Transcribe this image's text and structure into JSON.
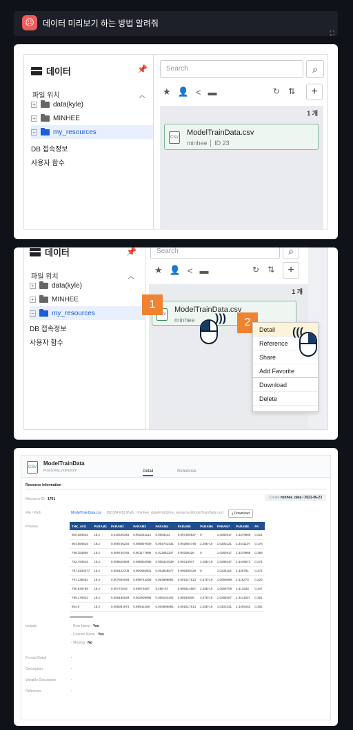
{
  "header": {
    "emoji": "☹",
    "title": "데이터 미리보기 하는 방법 알려줘",
    "expand_icon": "expand-icon"
  },
  "panel": {
    "title": "데이터",
    "section": "파일 위치",
    "tree": [
      "data(kyle)",
      "MINHEE",
      "my_resources"
    ],
    "menu": [
      "DB 접속정보",
      "사용자 함수"
    ],
    "search_placeholder": "Search",
    "count": "1 개",
    "file": {
      "name": "ModelTrainData.csv",
      "meta": "minhee │ ID 23",
      "meta_short": "minhee"
    }
  },
  "steps": {
    "one": "1",
    "two": "2"
  },
  "context_menu": [
    "Detail",
    "Reference",
    "Share",
    "Add Favorite",
    "Download",
    "Delete"
  ],
  "detail": {
    "title": "ModelTrainData",
    "path": "FILES>my_resources",
    "tabs": [
      "Detail",
      "Reference"
    ],
    "section": "Resource Information",
    "resource_id_label": "Resource ID",
    "resource_id": "1761",
    "create_label": "Create",
    "create_value": "minhee_data / 2021-06-23",
    "filepath_label": "File / Path",
    "file_link": "ModelTrainData.csv",
    "file_info": "[82,084 KB] [Path : /minhee_data/FILES/my_resources/ModelTrainData.csv]",
    "download": "Download",
    "preview_label": "Preview",
    "columns": [
      "THK_AVG",
      "PARAM1",
      "PARAM2",
      "PARAM3",
      "PARAM4",
      "PARAM5",
      "PARAM6",
      "PARAM7",
      "PARAM8",
      "PA"
    ],
    "rows": [
      [
        "800.384615",
        "18.2",
        "0.010426345",
        "0.902031114",
        "0.0063412",
        "0.907350537",
        "0",
        "1.0283917",
        "2.3379986",
        "0.314"
      ],
      [
        "804.584615",
        "18.2",
        "0.006736234",
        "0.896897009",
        "0.004741431",
        "0.902664746",
        "2.28E-16",
        "1.0303131",
        "2.3441107",
        "0.176"
      ],
      [
        "798.253846",
        "18.2",
        "0.009745765",
        "0.901177898",
        "0.011882337",
        "0.90306328",
        "0",
        "1.0283917",
        "2.3379986",
        "0.369"
      ],
      [
        "792.784615",
        "18.2",
        "0.008625669",
        "0.898804085",
        "0.006324039",
        "0.90313947",
        "2.28E-16",
        "1.0289437",
        "2.3445673",
        "0.374"
      ],
      [
        "797.0203077",
        "18.2",
        "0.009122705",
        "0.900856901",
        "0.002848577",
        "0.906390439",
        "0",
        "1.0235118",
        "2.336791",
        "0.272"
      ],
      [
        "797.138462",
        "18.2",
        "0.007804048",
        "0.898744265",
        "0.004896891",
        "0.901617813",
        "4.57E-16",
        "1.0056099",
        "2.316273",
        "0.223"
      ],
      [
        "790.930769",
        "18.2",
        "0.00772043",
        "0.89579287",
        "8.26E-04",
        "0.899314867",
        "2.28E-16",
        "1.0069759",
        "2.313533",
        "0.347"
      ],
      [
        "789.176923",
        "18.2",
        "0.008195549",
        "0.902909994",
        "0.008144401",
        "0.90549806",
        "4.57E-16",
        "1.0288467",
        "2.3411837",
        "0.361"
      ],
      [
        "804.9",
        "18.2",
        "0.006391974",
        "0.89941268",
        "0.004896891",
        "0.901617813",
        "2.28E-16",
        "1.0303131",
        "2.3409152",
        "0.362"
      ]
    ],
    "include_label": "Include",
    "include": [
      {
        "k": "Row Name :",
        "v": "Yes"
      },
      {
        "k": "Column Name :",
        "v": "Yes"
      },
      {
        "k": "Missing :",
        "v": "No"
      }
    ],
    "extra": [
      {
        "k": "Format Detail",
        "v": "-"
      },
      {
        "k": "Description",
        "v": "-"
      },
      {
        "k": "Variable Description",
        "v": "-"
      },
      {
        "k": "Reference",
        "v": "-"
      }
    ]
  }
}
